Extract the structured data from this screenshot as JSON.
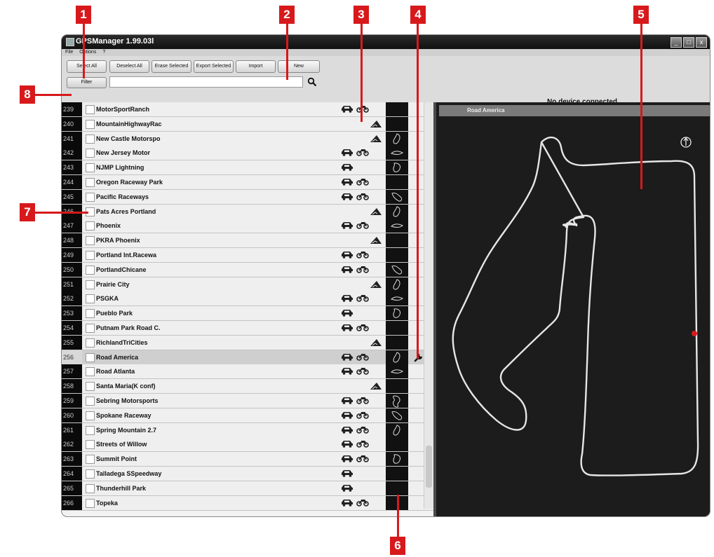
{
  "window": {
    "title": "GPSManager 1.99.03l",
    "min": "_",
    "max": "□",
    "close": "x"
  },
  "menu": [
    "File",
    "Options",
    "?"
  ],
  "toolbar": {
    "buttons": [
      "Select All",
      "Deselect All",
      "Erase Selected",
      "Export Selected",
      "Import",
      "New"
    ],
    "filter_label": "Filter"
  },
  "device_status": "No device connected",
  "map": {
    "title": "Road America"
  },
  "callouts": [
    "1",
    "2",
    "3",
    "4",
    "5",
    "6",
    "7",
    "8"
  ],
  "tracks": [
    {
      "num": "239",
      "name": "MotorSportRanch",
      "car": true,
      "bike": true,
      "mtn": false,
      "thumb": false
    },
    {
      "num": "240",
      "name": "MountainHighwayRac",
      "car": false,
      "bike": false,
      "mtn": true,
      "thumb": false
    },
    {
      "num": "241",
      "name": "New Castle Motorspo",
      "car": false,
      "bike": false,
      "mtn": true,
      "thumb": true
    },
    {
      "num": "242",
      "name": "New Jersey Motor",
      "car": true,
      "bike": true,
      "mtn": false,
      "thumb": true
    },
    {
      "num": "243",
      "name": "NJMP Lightning",
      "car": true,
      "bike": false,
      "mtn": false,
      "thumb": true
    },
    {
      "num": "244",
      "name": "Oregon Raceway Park",
      "car": true,
      "bike": true,
      "mtn": false,
      "thumb": false
    },
    {
      "num": "245",
      "name": "Pacific Raceways",
      "car": true,
      "bike": true,
      "mtn": false,
      "thumb": true
    },
    {
      "num": "246",
      "name": "Pats Acres Portland",
      "car": false,
      "bike": false,
      "mtn": true,
      "thumb": true
    },
    {
      "num": "247",
      "name": "Phoenix",
      "car": true,
      "bike": true,
      "mtn": false,
      "thumb": true
    },
    {
      "num": "248",
      "name": "PKRA Phoenix",
      "car": false,
      "bike": false,
      "mtn": true,
      "thumb": false
    },
    {
      "num": "249",
      "name": "Portland Int.Racewa",
      "car": true,
      "bike": true,
      "mtn": false,
      "thumb": false
    },
    {
      "num": "250",
      "name": "PortlandChicane",
      "car": true,
      "bike": true,
      "mtn": false,
      "thumb": true
    },
    {
      "num": "251",
      "name": "Prairie City",
      "car": false,
      "bike": false,
      "mtn": true,
      "thumb": true
    },
    {
      "num": "252",
      "name": "PSGKA",
      "car": true,
      "bike": true,
      "mtn": false,
      "thumb": true
    },
    {
      "num": "253",
      "name": "Pueblo Park",
      "car": true,
      "bike": false,
      "mtn": false,
      "thumb": true
    },
    {
      "num": "254",
      "name": "Putnam Park Road C.",
      "car": true,
      "bike": true,
      "mtn": false,
      "thumb": false
    },
    {
      "num": "255",
      "name": "RichlandTriCities",
      "car": false,
      "bike": false,
      "mtn": true,
      "thumb": false
    },
    {
      "num": "256",
      "name": "Road America",
      "car": true,
      "bike": true,
      "mtn": false,
      "thumb": true,
      "selected": true
    },
    {
      "num": "257",
      "name": "Road Atlanta",
      "car": true,
      "bike": true,
      "mtn": false,
      "thumb": true
    },
    {
      "num": "258",
      "name": "Santa Maria(K conf)",
      "car": false,
      "bike": false,
      "mtn": true,
      "thumb": false
    },
    {
      "num": "259",
      "name": "Sebring Motorsports",
      "car": true,
      "bike": true,
      "mtn": false,
      "thumb": true
    },
    {
      "num": "260",
      "name": "Spokane Raceway",
      "car": true,
      "bike": true,
      "mtn": false,
      "thumb": true
    },
    {
      "num": "261",
      "name": "Spring Mountain 2.7",
      "car": true,
      "bike": true,
      "mtn": false,
      "thumb": true
    },
    {
      "num": "262",
      "name": "Streets of Willow",
      "car": true,
      "bike": true,
      "mtn": false,
      "thumb": false
    },
    {
      "num": "263",
      "name": "Summit Point",
      "car": true,
      "bike": true,
      "mtn": false,
      "thumb": true
    },
    {
      "num": "264",
      "name": "Talladega SSpeedway",
      "car": true,
      "bike": false,
      "mtn": false,
      "thumb": false
    },
    {
      "num": "265",
      "name": "Thunderhill Park",
      "car": true,
      "bike": false,
      "mtn": false,
      "thumb": false
    },
    {
      "num": "266",
      "name": "Topeka",
      "car": true,
      "bike": true,
      "mtn": false,
      "thumb": false
    }
  ]
}
